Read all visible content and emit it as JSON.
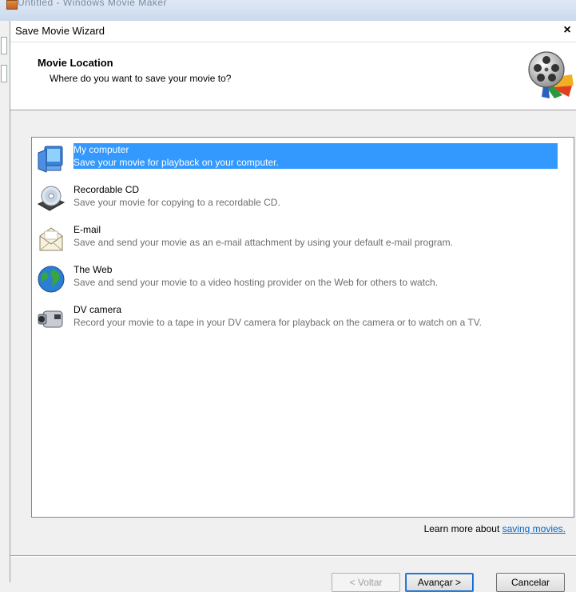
{
  "background_window": {
    "title": "Untitled - Windows Movie Maker"
  },
  "dialog": {
    "title": "Save Movie Wizard",
    "close_label": "×",
    "header": {
      "title": "Movie Location",
      "subtitle": "Where do you want to save your movie to?"
    },
    "items": [
      {
        "name": "My computer",
        "description": "Save your movie for playback on your computer.",
        "icon": "monitor-icon",
        "selected": true
      },
      {
        "name": "Recordable CD",
        "description": "Save your movie for copying to a recordable CD.",
        "icon": "cd-icon",
        "selected": false
      },
      {
        "name": "E-mail",
        "description": "Save and send your movie as an e-mail attachment by using your default e-mail program.",
        "icon": "envelope-icon",
        "selected": false
      },
      {
        "name": "The Web",
        "description": "Save and send your movie to a video hosting provider on the Web for others to watch.",
        "icon": "globe-icon",
        "selected": false
      },
      {
        "name": "DV camera",
        "description": "Record your movie to a tape in your DV camera for playback on the camera or to watch on a TV.",
        "icon": "camera-icon",
        "selected": false
      }
    ],
    "learn_more": {
      "prefix": "Learn more about ",
      "link": "saving movies."
    },
    "buttons": {
      "back": "< Voltar",
      "next": "Avançar >",
      "cancel": "Cancelar"
    },
    "colors": {
      "selection": "#3399ff",
      "link": "#0066cc"
    }
  }
}
